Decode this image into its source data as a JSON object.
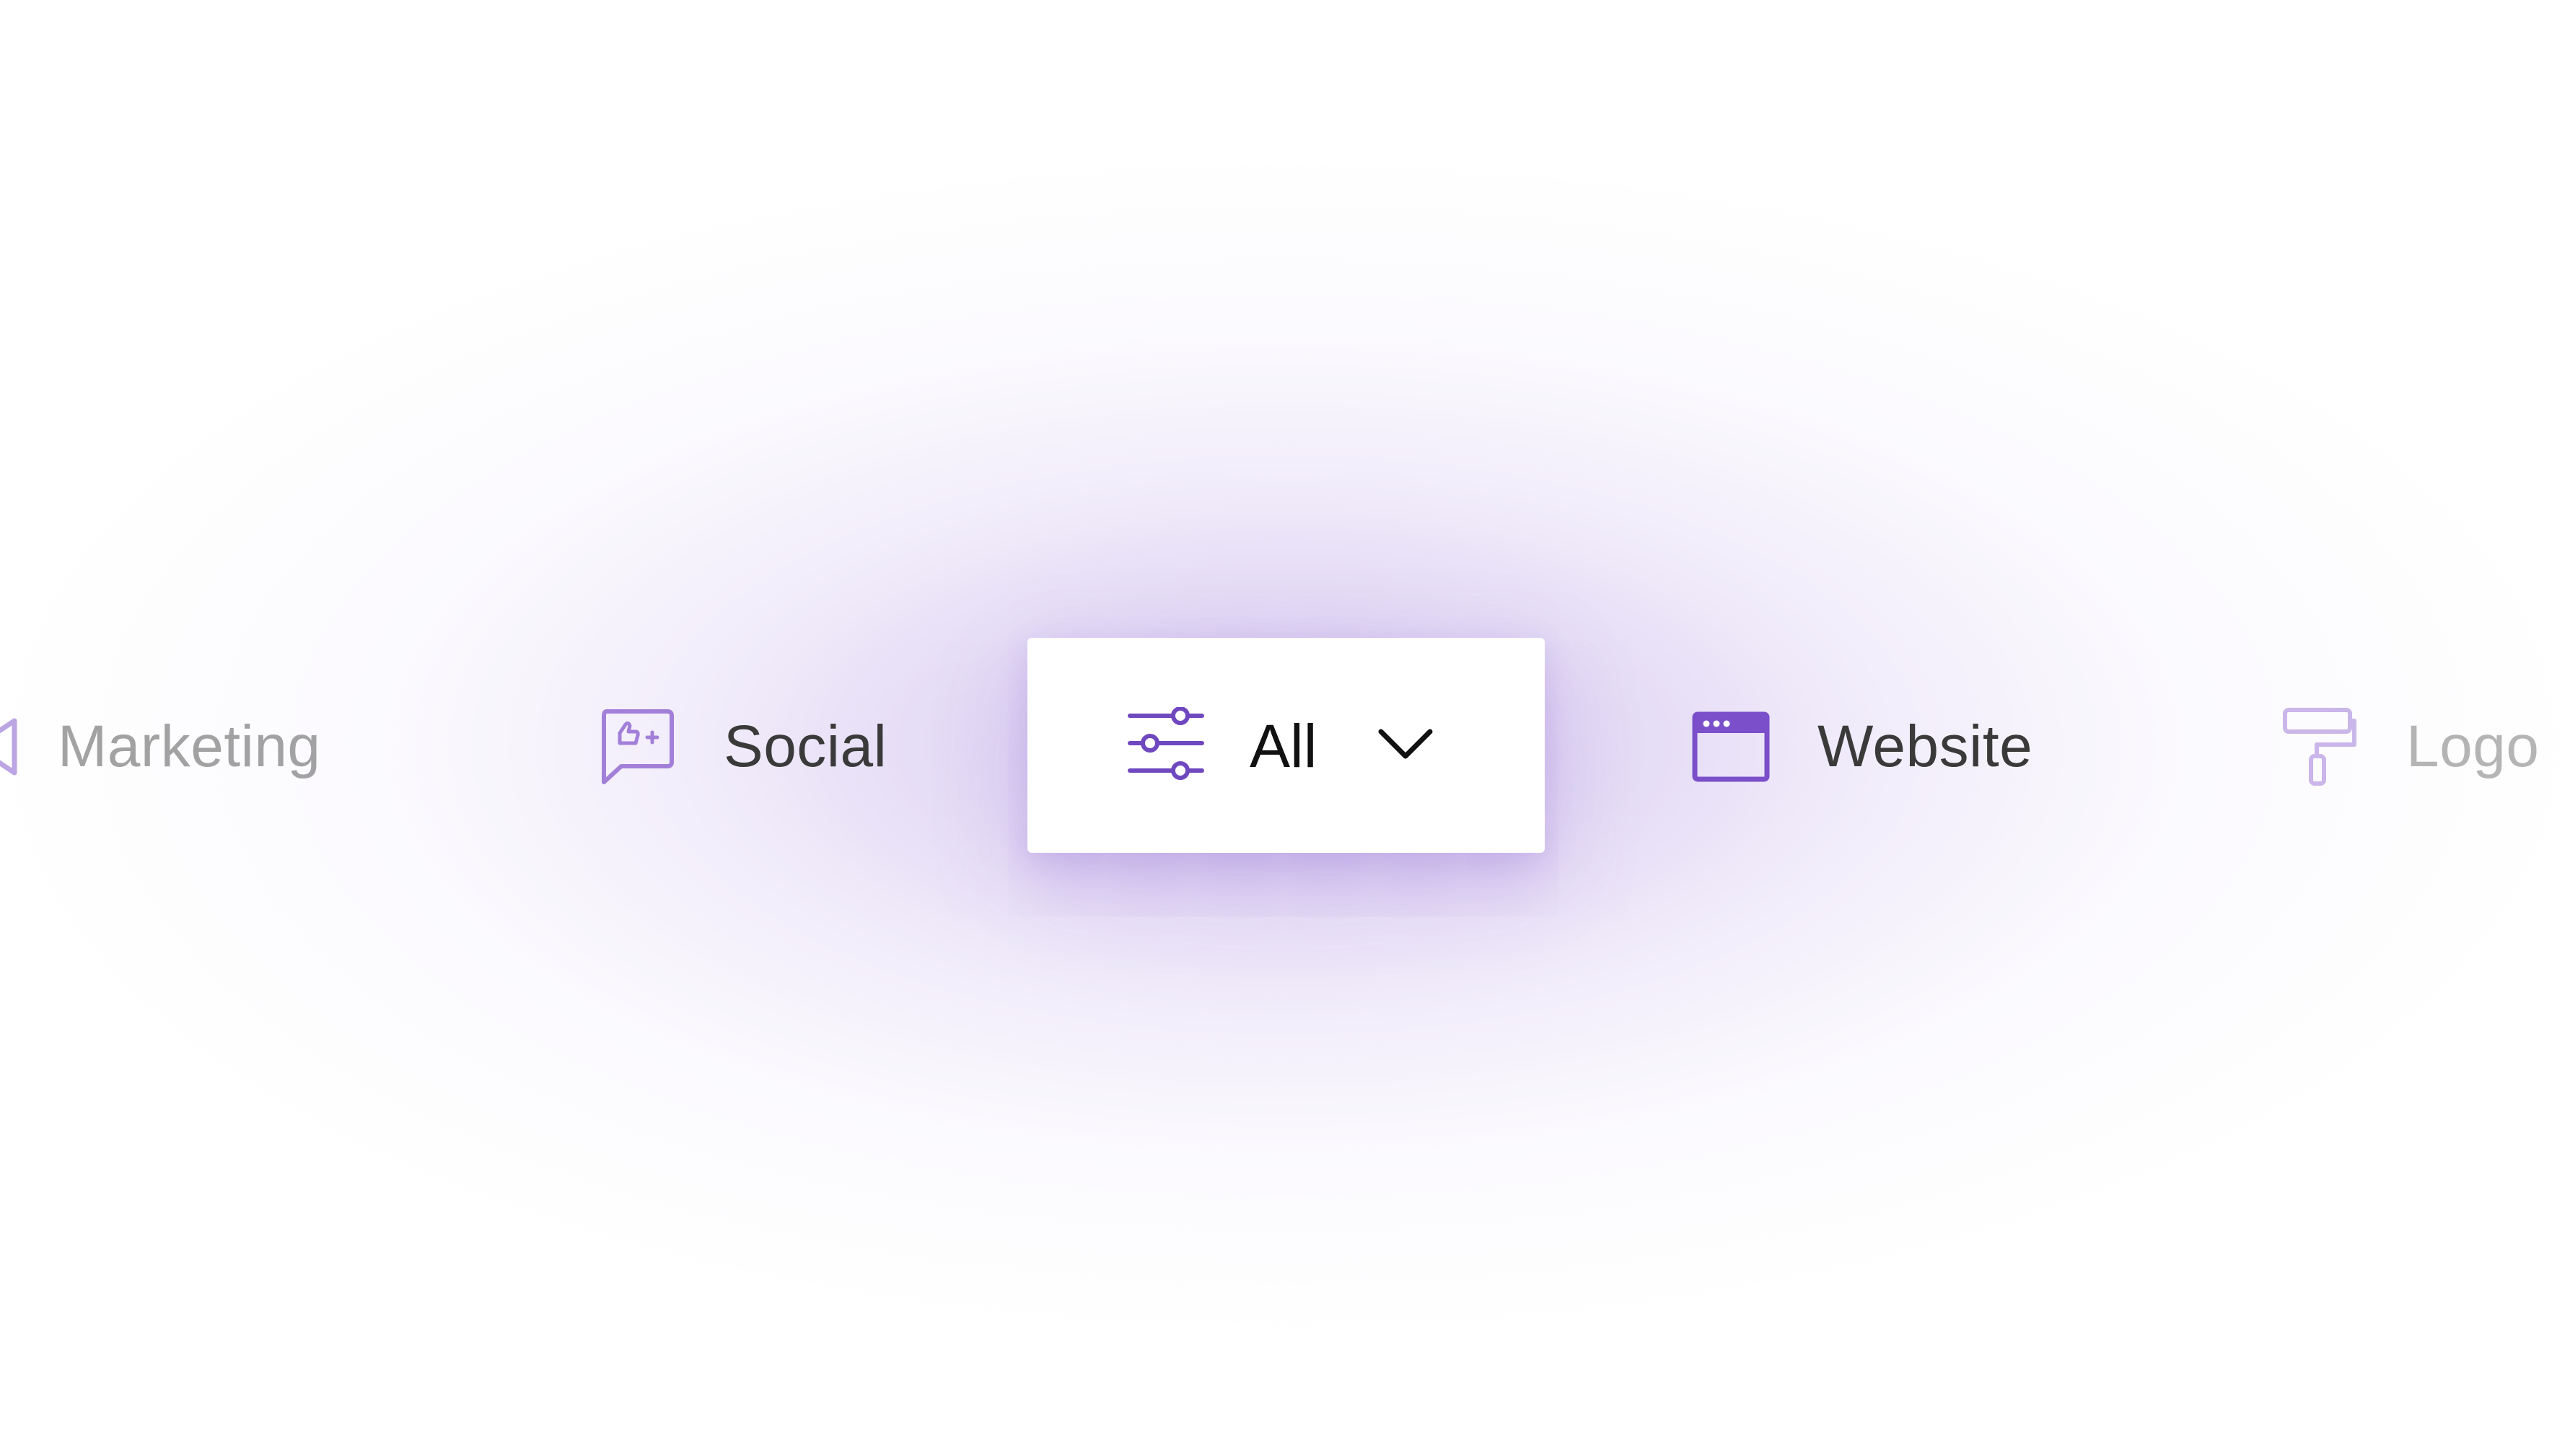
{
  "categories": {
    "marketing": {
      "label": "Marketing",
      "icon": "megaphone-icon"
    },
    "social": {
      "label": "Social",
      "icon": "speech-bubble-thumbs-up-icon"
    },
    "all": {
      "label": "All",
      "icon": "sliders-filter-icon",
      "dropdown_icon": "chevron-down-icon"
    },
    "website": {
      "label": "Website",
      "icon": "browser-window-icon"
    },
    "logo": {
      "label": "Logo",
      "icon": "paint-roller-icon"
    }
  },
  "colors": {
    "accent": "#7a4fc9",
    "glow": "#c6b2ea",
    "text_active": "#111111",
    "text_near": "#3a3a3a",
    "text_far": "#a6a6a6"
  }
}
